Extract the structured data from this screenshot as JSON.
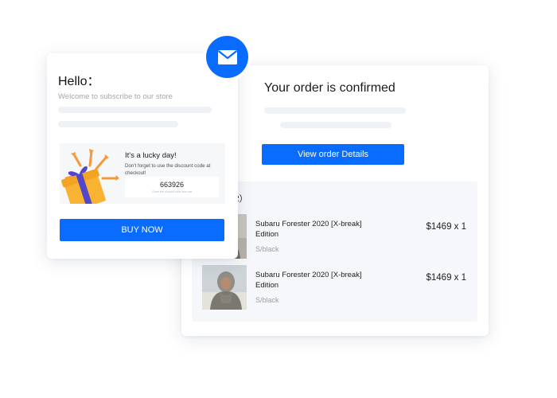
{
  "colors": {
    "accent": "#0a6cff",
    "panel_bg": "#f5f7fa",
    "skeleton": "#eef1f5"
  },
  "mail_badge": {
    "icon": "envelope-icon"
  },
  "subscribe_card": {
    "greeting": "Hello：",
    "welcome_text": "Welcome to subscribe to our store",
    "coupon": {
      "icon": "gift-box-icon",
      "title": "It's a lucky day!",
      "message": "Don't forget to use the discount code at checkout!",
      "code": "663926",
      "hint": "Close the coupon code and use"
    },
    "buy_button": "BUY NOW"
  },
  "order_card": {
    "title": "Your order is confirmed",
    "view_button": "View order Details",
    "items_header": "l（2）",
    "items": [
      {
        "name": "Subaru Forester 2020 [X-break] Edition",
        "variant": "S/black",
        "price": "$1469 x 1"
      },
      {
        "name": "Subaru Forester 2020 [X-break] Edition",
        "variant": "S/black",
        "price": "$1469 x 1"
      }
    ]
  }
}
